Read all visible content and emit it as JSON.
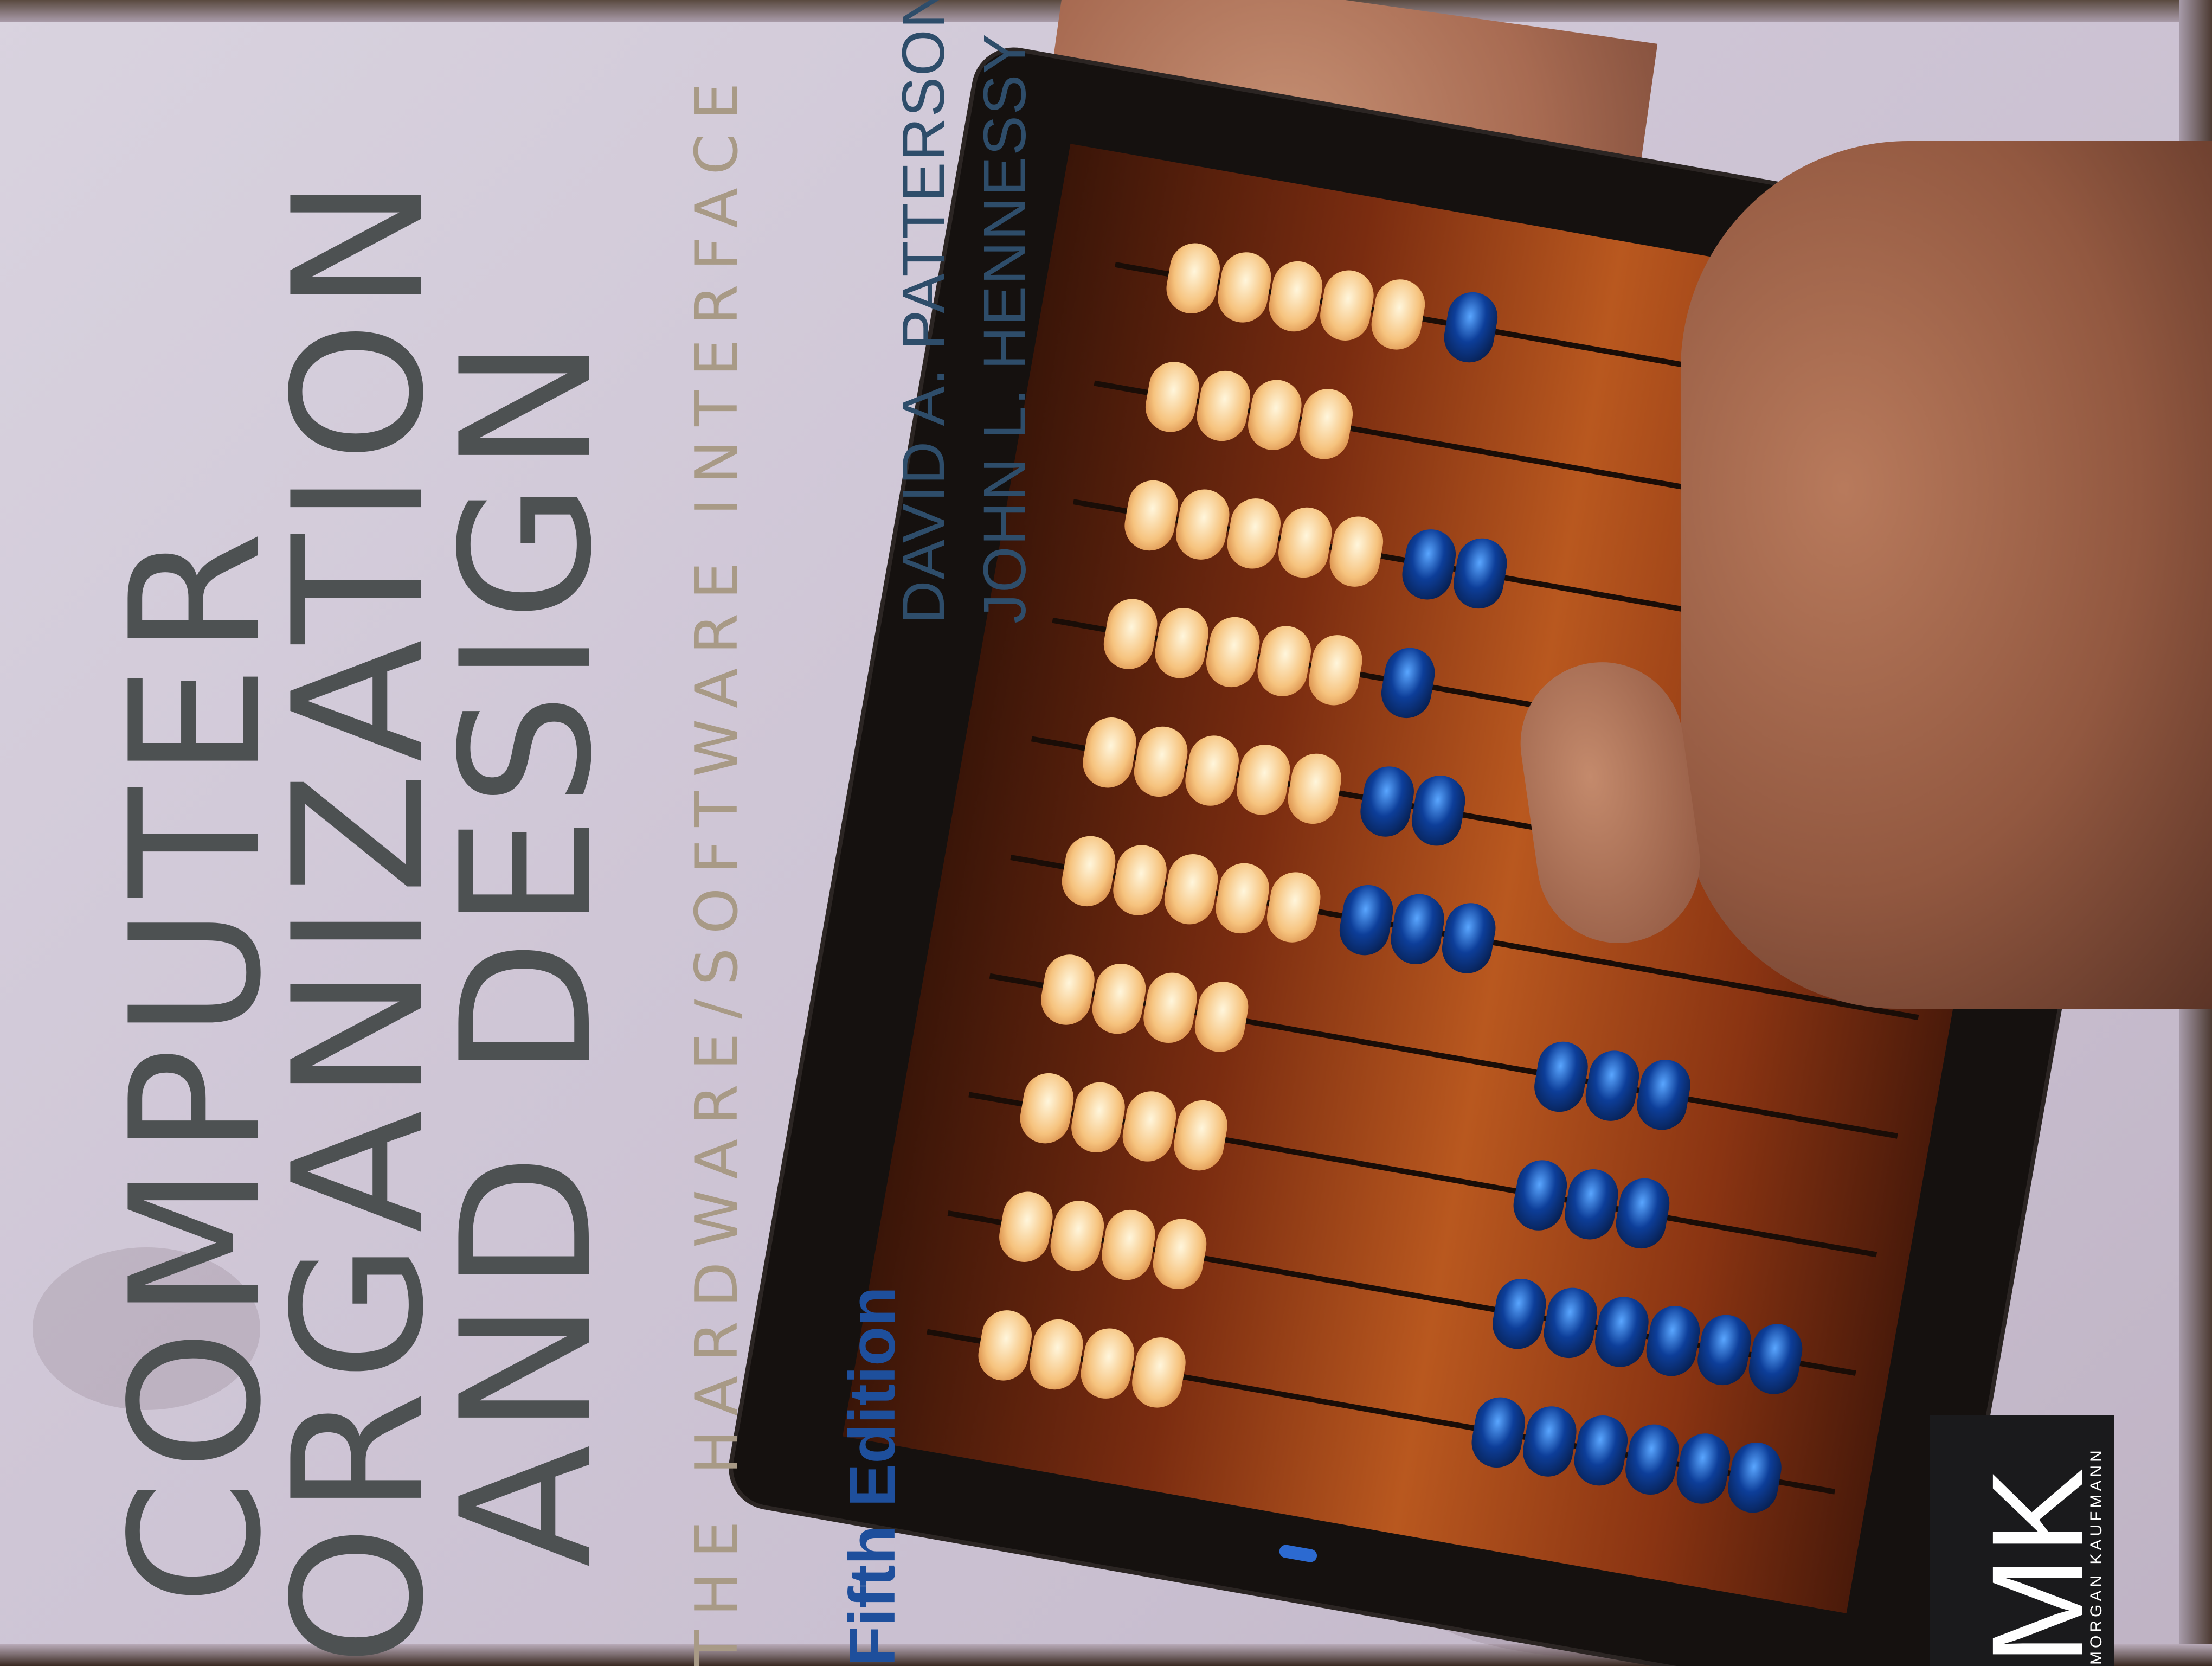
{
  "cover": {
    "title_line_1": "COMPUTER",
    "title_line_2": "ORGANIZATION",
    "title_line_3": "AND DESIGN",
    "subtitle": "THE HARDWARE/SOFTWARE INTERFACE",
    "edition": "Fifth Edition",
    "author_1": "DAVID A. PATTERSON",
    "author_2": "JOHN L. HENNESSY",
    "publisher_mark": "MK",
    "publisher_name": "MORGAN KAUFMANN"
  },
  "colors": {
    "cover_background": "#cfc6d6",
    "title_text": "#4d5152",
    "subtitle_text": "#a89a86",
    "edition_text": "#1e4f9c",
    "author_text": "#2e4d6a",
    "abacus_light_bead": "#f6c37e",
    "abacus_dark_bead": "#0d3e99",
    "tablet_frame": "#15110f"
  }
}
